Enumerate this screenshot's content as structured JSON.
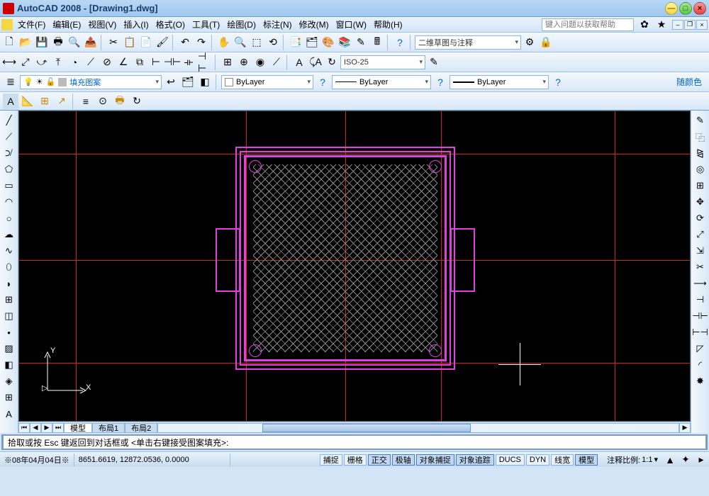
{
  "titlebar": {
    "title": "AutoCAD 2008 - [Drawing1.dwg]"
  },
  "menus": [
    "文件(F)",
    "编辑(E)",
    "视图(V)",
    "插入(I)",
    "格式(O)",
    "工具(T)",
    "绘图(D)",
    "标注(N)",
    "修改(M)",
    "窗口(W)",
    "帮助(H)"
  ],
  "help_placeholder": "键入问题以获取帮助",
  "workspace_preset": "二维草图与注释",
  "dim_style": "ISO-25",
  "layer_name": "填充图案",
  "bylayer": "ByLayer",
  "bycolor_label": "随颜色",
  "tabs": {
    "model": "模型",
    "layout1": "布局1",
    "layout2": "布局2"
  },
  "command_prompt": "拾取或按 Esc 键返回到对话框或 <单击右键接受图案填充>:",
  "status": {
    "date": "※08年04月04日※",
    "coords": "8651.6619,  12872.0536, 0.0000",
    "toggles": [
      "捕捉",
      "栅格",
      "正交",
      "极轴",
      "对象捕捉",
      "对象追踪",
      "DUCS",
      "DYN",
      "线宽",
      "模型"
    ],
    "scale_label": "注释比例:",
    "scale_value": "1:1"
  }
}
